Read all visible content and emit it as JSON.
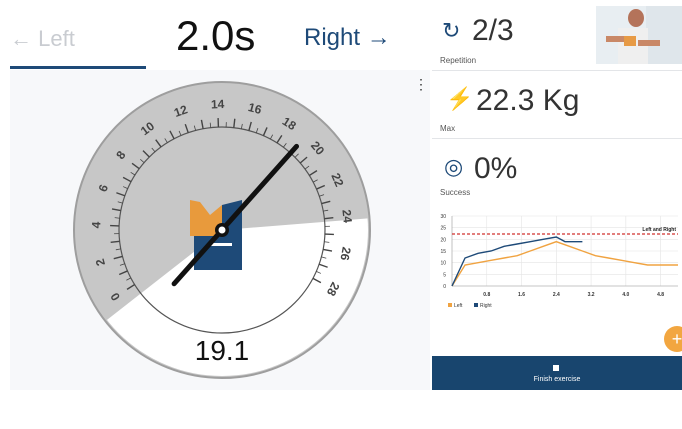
{
  "header": {
    "left_label": "← Left",
    "timer": "2.0s",
    "right_label": "Right →"
  },
  "gauge": {
    "value_display": "19.1",
    "scale_ticks": [
      "0",
      "2",
      "4",
      "6",
      "8",
      "10",
      "12",
      "14",
      "16",
      "18",
      "20",
      "22",
      "24",
      "26",
      "28"
    ],
    "needle_value": 19.1,
    "scale_min": 0,
    "scale_max": 28,
    "colors": {
      "dial": "#c7c7c7",
      "orange": "#e89a3c",
      "navy": "#1e4a78",
      "needle": "#111111"
    }
  },
  "stats": {
    "repetition": {
      "value": "2/3",
      "caption": "Repetition",
      "icon": "refresh-icon"
    },
    "max": {
      "value": "22.3 Kg",
      "caption": "Max",
      "icon": "lightning-icon"
    },
    "success": {
      "value": "0%",
      "caption": "Success",
      "icon": "target-icon"
    }
  },
  "chart_data": {
    "type": "line",
    "annotation": "Left and Right",
    "y_ticks": [
      "30",
      "25",
      "20",
      "15",
      "10",
      "5",
      "0"
    ],
    "x_ticks": [
      "0.8",
      "1.6",
      "2.4",
      "3.2",
      "4.0",
      "4.8"
    ],
    "ylim": [
      0,
      30
    ],
    "xlim": [
      0,
      5.2
    ],
    "threshold": 22.3,
    "series": [
      {
        "name": "Left",
        "color": "#f0a341",
        "x": [
          0,
          0.3,
          0.6,
          0.9,
          1.2,
          1.5,
          1.8,
          2.1,
          2.4,
          2.7,
          3.0,
          3.3,
          3.6,
          3.9,
          4.2,
          4.5,
          4.8,
          5.2
        ],
        "y": [
          0,
          9,
          10,
          11,
          12,
          13,
          15,
          17,
          19,
          17,
          15,
          13,
          12,
          11,
          10,
          9,
          9,
          9
        ]
      },
      {
        "name": "Right",
        "color": "#1e4a78",
        "x": [
          0,
          0.3,
          0.6,
          0.9,
          1.2,
          1.5,
          1.8,
          2.1,
          2.4,
          2.6,
          2.8,
          3.0
        ],
        "y": [
          0,
          12,
          14,
          15,
          17,
          18,
          19,
          20,
          21,
          19,
          19,
          19
        ]
      }
    ],
    "legend": [
      "Left",
      "Right"
    ]
  },
  "footer": {
    "finish_label": "Finish exercise",
    "fab_symbol": "+"
  }
}
